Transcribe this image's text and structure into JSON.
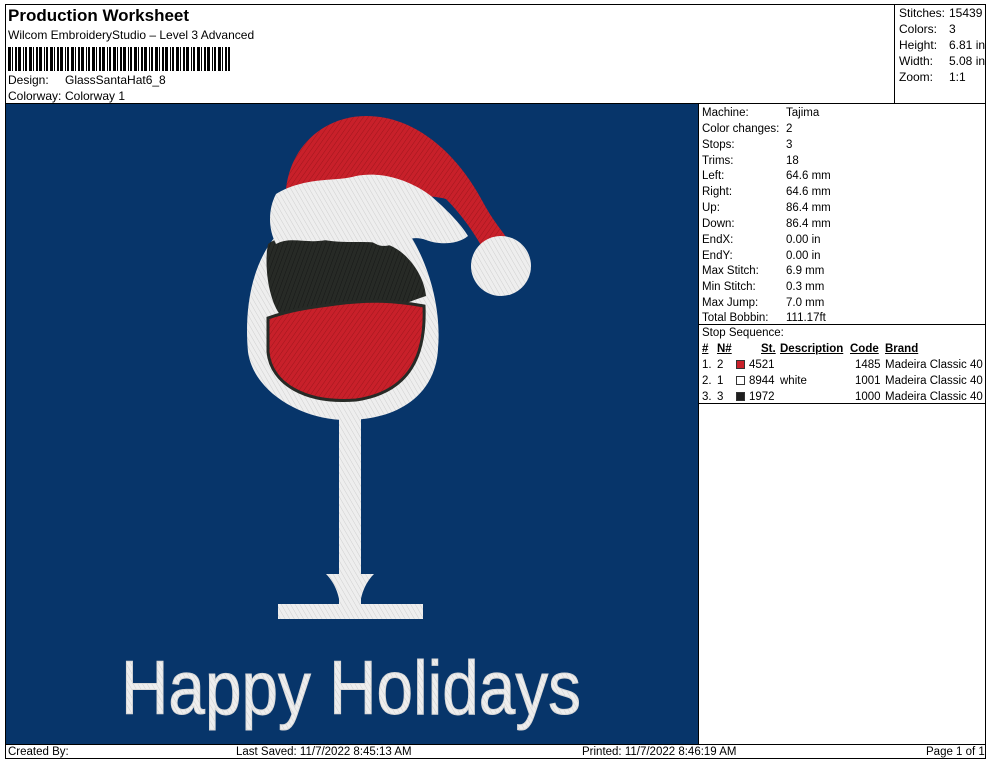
{
  "header": {
    "title": "Production Worksheet",
    "software": "Wilcom EmbroideryStudio – Level 3 Advanced",
    "design_label": "Design:",
    "design_value": "GlassSantaHat6_8",
    "colorway_label": "Colorway:",
    "colorway_value": "Colorway 1"
  },
  "summary": [
    {
      "label": "Stitches:",
      "value": "15439"
    },
    {
      "label": "Colors:",
      "value": "3"
    },
    {
      "label": "Height:",
      "value": "6.81 in"
    },
    {
      "label": "Width:",
      "value": "5.08 in"
    },
    {
      "label": "Zoom:",
      "value": "1:1"
    }
  ],
  "stats": [
    {
      "label": "Machine:",
      "value": "Tajima"
    },
    {
      "label": "Color changes:",
      "value": "2"
    },
    {
      "label": "Stops:",
      "value": "3"
    },
    {
      "label": "Trims:",
      "value": "18"
    },
    {
      "label": "Left:",
      "value": "64.6 mm"
    },
    {
      "label": "Right:",
      "value": "64.6 mm"
    },
    {
      "label": "Up:",
      "value": "86.4 mm"
    },
    {
      "label": "Down:",
      "value": "86.4 mm"
    },
    {
      "label": "EndX:",
      "value": "0.00 in"
    },
    {
      "label": "EndY:",
      "value": "0.00 in"
    },
    {
      "label": "Max Stitch:",
      "value": "6.9 mm"
    },
    {
      "label": "Min Stitch:",
      "value": "0.3 mm"
    },
    {
      "label": "Max Jump:",
      "value": "7.0 mm"
    },
    {
      "label": "Total Bobbin:",
      "value": "111.17ft"
    }
  ],
  "stop_sequence": {
    "title": "Stop Sequence:",
    "headers": {
      "num": "#",
      "n": "N#",
      "st": "St.",
      "description": "Description",
      "code": "Code",
      "brand": "Brand"
    },
    "rows": [
      {
        "num": "1.",
        "n": "2",
        "color": "#c8202a",
        "st": "4521",
        "description": "",
        "code": "1485",
        "brand": "Madeira Classic 40"
      },
      {
        "num": "2.",
        "n": "1",
        "color": "#ffffff",
        "st": "8944",
        "description": "white",
        "code": "1001",
        "brand": "Madeira Classic 40"
      },
      {
        "num": "3.",
        "n": "3",
        "color": "#1e1e1e",
        "st": "1972",
        "description": "",
        "code": "1000",
        "brand": "Madeira Classic 40"
      }
    ]
  },
  "design_text": "Happy Holidays",
  "colors": {
    "canvas": "#07356a",
    "red": "#c8202a",
    "white": "#eeeeee",
    "dark": "#272a26"
  },
  "footer": {
    "created": "Created By:",
    "saved": "Last Saved: 11/7/2022 8:45:13 AM",
    "printed": "Printed: 11/7/2022 8:46:19 AM",
    "page": "Page 1 of 1"
  }
}
